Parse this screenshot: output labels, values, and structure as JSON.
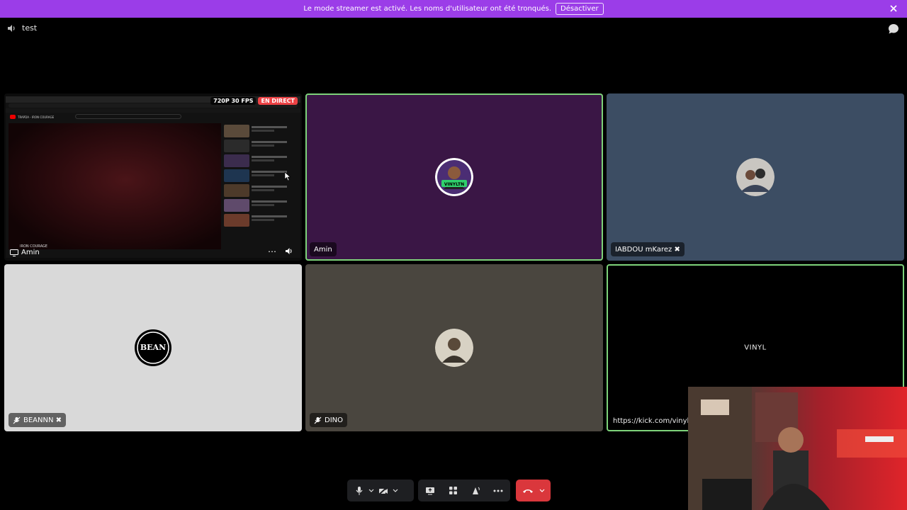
{
  "banner": {
    "message": "Le mode streamer est activé. Les noms d'utilisateur ont été tronqués.",
    "button_label": "Désactiver"
  },
  "channel": {
    "name": "test"
  },
  "screen_share": {
    "user": "Amin",
    "quality_badge": "720P 30 FPS",
    "live_badge": "EN DIRECT",
    "page_title": "TRAPDA - IRON COURAGE",
    "video_caption": "IRON COURAGE"
  },
  "tiles": [
    {
      "user": "Amin",
      "avatar_text": "VINYLTN",
      "speaking": true
    },
    {
      "user": "IABDOU mKarez ✖",
      "speaking": false
    },
    {
      "user": "BEANNN ✖",
      "avatar_text": "BEAN",
      "muted": true
    },
    {
      "user": "DINO",
      "muted": true
    },
    {
      "user": "https://kick.com/vinyltn",
      "logo_text": "VINYL"
    }
  ],
  "controls": {
    "icons": [
      "microphone-icon",
      "video-off-icon",
      "screen-share-icon",
      "activities-icon",
      "soundboard-icon",
      "more-icon",
      "hang-up-icon"
    ]
  },
  "colors": {
    "banner": "#9b3de8",
    "speaking_outline": "#7ed37a",
    "live_red": "#ed4245",
    "hangup": "#da373c"
  }
}
